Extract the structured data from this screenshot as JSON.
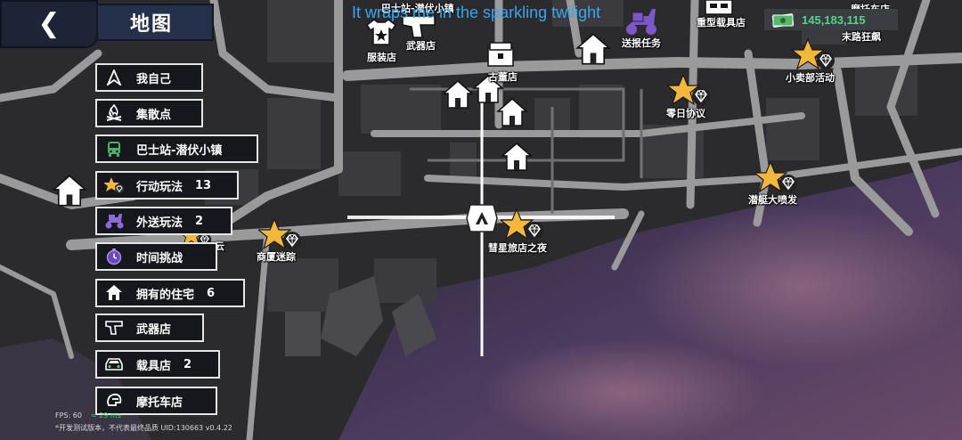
{
  "header": {
    "back_icon": "chevron-left-icon",
    "title": "地图",
    "banner": "It wraps me in the sparkling twilight"
  },
  "currency": {
    "icon": "cash-icon",
    "amount": "145,183,115"
  },
  "menu": [
    {
      "icon": "location-arrow-icon",
      "label": "我自己",
      "count": ""
    },
    {
      "icon": "campfire-icon",
      "label": "集散点",
      "count": ""
    },
    {
      "icon": "bus-icon",
      "label": "巴士站-潜伏小镇",
      "count": ""
    },
    {
      "icon": "star-diamond-icon",
      "label": "行动玩法",
      "count": "13"
    },
    {
      "icon": "delivery-scooter-icon",
      "label": "外送玩法",
      "count": "2"
    },
    {
      "icon": "stopwatch-icon",
      "label": "时间挑战",
      "count": ""
    },
    {
      "icon": "house-icon",
      "label": "拥有的住宅",
      "count": "6"
    },
    {
      "icon": "pistol-icon",
      "label": "武器店",
      "count": ""
    },
    {
      "icon": "car-icon",
      "label": "载具店",
      "count": "2"
    },
    {
      "icon": "motorcycle-helmet-icon",
      "label": "摩托车店",
      "count": ""
    }
  ],
  "map_labels": {
    "bus_stop": "巴士站-潜伏小镇",
    "clothing_store": "服装店",
    "weapon_store": "武器店",
    "antique_store": "古董店",
    "delivery_job": "送报任务",
    "heavy_vehicle_store": "重型载具店",
    "moto_store": "摩托车店",
    "last_road_rage": "末路狂飙",
    "snack_shop_event": "小卖部活动",
    "zero_day_protocol": "零日协议",
    "speedboat_rush": "潜艇大喷发",
    "hotel_night": "彗星旅店之夜",
    "mall_maze": "商厦迷踪",
    "cloud": "云"
  },
  "status": {
    "fps": "FPS: 60",
    "ping": "29 ms",
    "version_line": "*开发测试版本，不代表最终品质   UID:130663   v0.4.22"
  },
  "colors": {
    "menu_bg": "#15171c",
    "title_bg": "#25304a",
    "star": "#f2b73b",
    "money": "#54d38b",
    "banner": "#37a6f0",
    "delivery": "#7a58c8"
  }
}
